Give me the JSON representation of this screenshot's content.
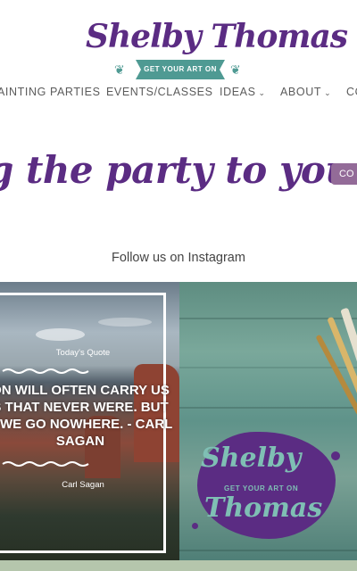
{
  "logo": {
    "name": "Shelby Thomas",
    "tagline": "GET YOUR ART ON"
  },
  "nav": {
    "items": [
      {
        "label": "AINTING PARTIES"
      },
      {
        "label": "EVENTS/CLASSES"
      },
      {
        "label": "IDEAS"
      },
      {
        "label": "ABOUT"
      },
      {
        "label": "CO"
      }
    ]
  },
  "hero": {
    "headline": "g the party to you!",
    "cta_label": "CO"
  },
  "instagram": {
    "heading": "Follow us on Instagram",
    "post1": {
      "heading": "Today's Quote",
      "quote": "ON WILL OFTEN CARRY US\nS THAT NEVER WERE. BUT\nT WE GO NOWHERE. - CARL\nSAGAN",
      "author": "Carl Sagan"
    },
    "post2": {
      "logo_line1": "Shelby",
      "logo_sub": "GET YOUR ART ON",
      "logo_line2": "Thomas"
    }
  },
  "colors": {
    "brand_purple": "#5b2c83",
    "teal": "#4f9a93",
    "button_mauve": "#936b98",
    "footer_sage": "#b5c6ac"
  }
}
